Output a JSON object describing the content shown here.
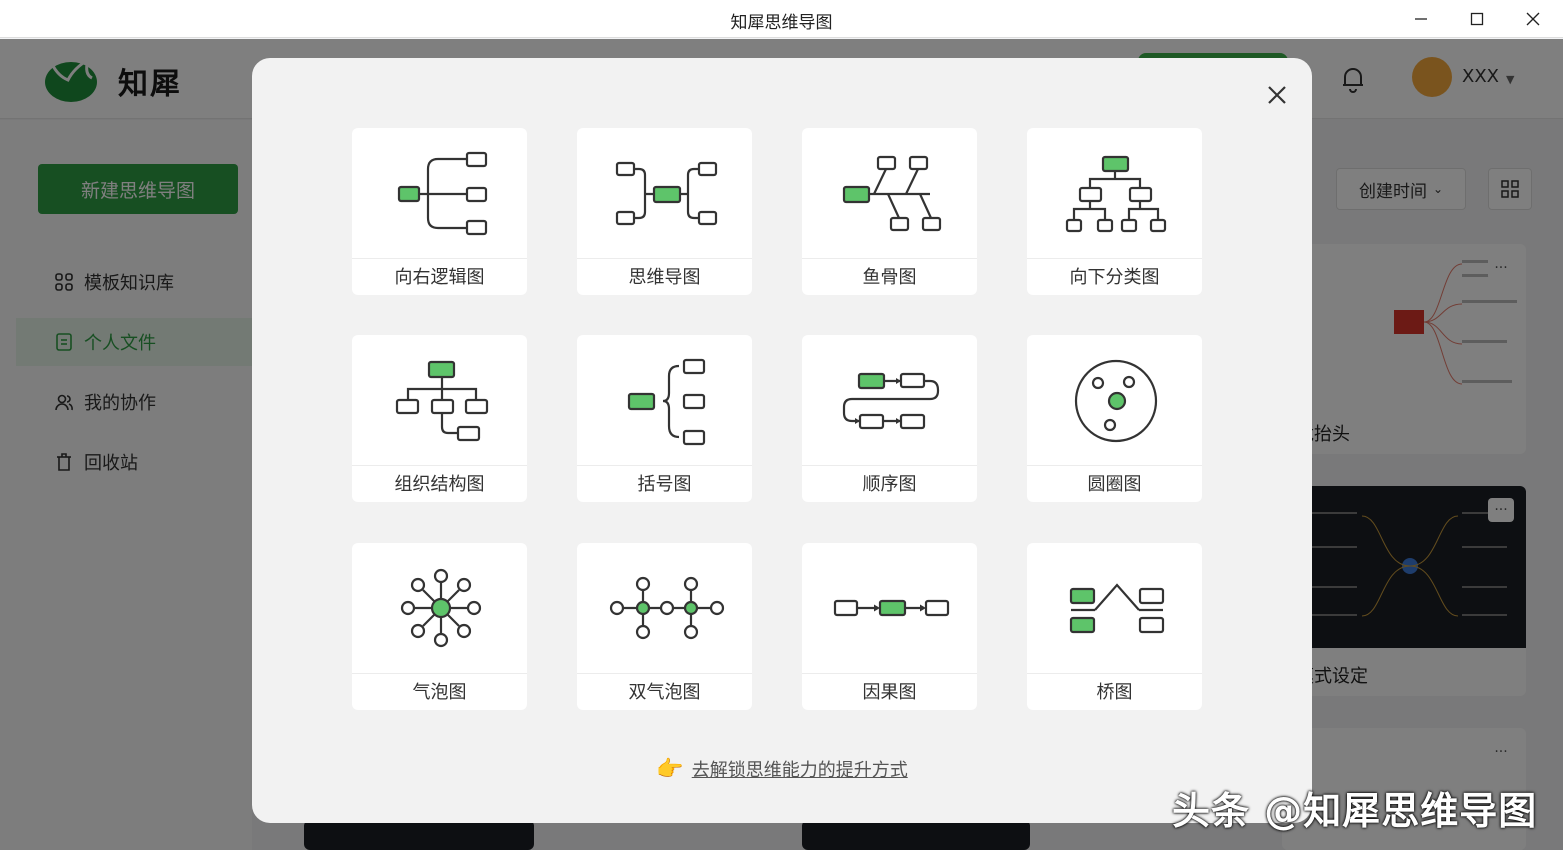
{
  "window": {
    "title": "知犀思维导图"
  },
  "app": {
    "logo_text": "知犀",
    "username": "XXX",
    "new_button": "新建思维导图",
    "sort_label": "创建时间"
  },
  "sidebar": {
    "items": [
      {
        "label": "模板知识库",
        "icon": "grid-icon"
      },
      {
        "label": "个人文件",
        "icon": "file-icon",
        "active": true
      },
      {
        "label": "我的协作",
        "icon": "users-icon"
      },
      {
        "label": "回收站",
        "icon": "trash-icon"
      }
    ]
  },
  "files": [
    {
      "name": "龙抬头"
    },
    {
      "name": "模式设定"
    }
  ],
  "modal": {
    "templates": [
      {
        "label": "向右逻辑图",
        "icon": "right-logic-icon"
      },
      {
        "label": "思维导图",
        "icon": "mind-map-icon"
      },
      {
        "label": "鱼骨图",
        "icon": "fishbone-icon"
      },
      {
        "label": "向下分类图",
        "icon": "down-tree-icon"
      },
      {
        "label": "组织结构图",
        "icon": "org-chart-icon"
      },
      {
        "label": "括号图",
        "icon": "brace-map-icon"
      },
      {
        "label": "顺序图",
        "icon": "flow-sequence-icon"
      },
      {
        "label": "圆圈图",
        "icon": "circle-map-icon"
      },
      {
        "label": "气泡图",
        "icon": "bubble-map-icon"
      },
      {
        "label": "双气泡图",
        "icon": "double-bubble-icon"
      },
      {
        "label": "因果图",
        "icon": "cause-effect-icon"
      },
      {
        "label": "桥图",
        "icon": "bridge-map-icon"
      }
    ],
    "unlock_text": "去解锁思维能力的提升方式"
  },
  "watermark": "头条 @知犀思维导图",
  "colors": {
    "brand_green": "#2f9e44",
    "node_green": "#5ec46a",
    "stroke": "#333333"
  }
}
